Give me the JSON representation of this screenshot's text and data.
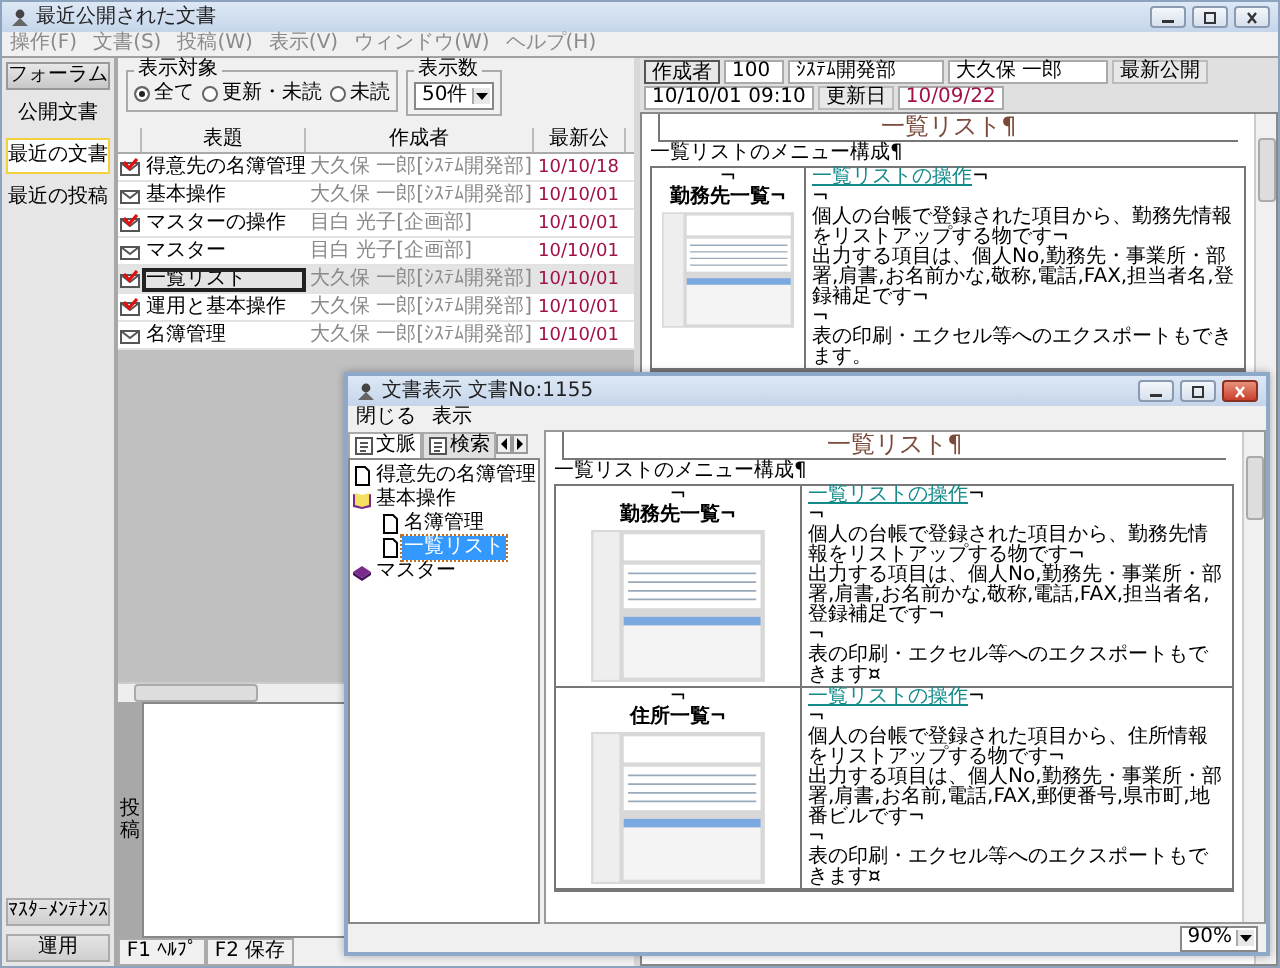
{
  "main_window": {
    "title": "最近公開された文書",
    "menu": [
      "操作(F)",
      "文書(S)",
      "投稿(W)",
      "表示(V)",
      "ウィンドウ(W)",
      "ヘルプ(H)"
    ]
  },
  "nav": {
    "header": "フォーラム",
    "items": [
      {
        "label": "公開文書",
        "selected": false
      },
      {
        "label": "最近の文書",
        "selected": true
      },
      {
        "label": "最近の投稿",
        "selected": false
      }
    ],
    "footer": [
      "ﾏｽﾀｰﾒﾝﾃﾅﾝｽ",
      "運用"
    ]
  },
  "filter": {
    "target_label": "表示対象",
    "options": [
      {
        "label": "全て",
        "selected": true
      },
      {
        "label": "更新・未読",
        "selected": false
      },
      {
        "label": "未読",
        "selected": false
      }
    ],
    "count_label": "表示数",
    "count_value": "50件"
  },
  "doc_list": {
    "columns": [
      "表題",
      "作成者",
      "最新公"
    ],
    "rows": [
      {
        "title": "得意先の名簿管理",
        "author": "大久保 一郎[ｼｽﾃﾑ開発部]",
        "date": "10/10/18",
        "kind": "updated",
        "selected": false
      },
      {
        "title": "基本操作",
        "author": "大久保 一郎[ｼｽﾃﾑ開発部]",
        "date": "10/10/01",
        "kind": "read",
        "selected": false
      },
      {
        "title": "マスターの操作",
        "author": "目白 光子[企画部]",
        "date": "10/10/01",
        "kind": "updated",
        "selected": false
      },
      {
        "title": "マスター",
        "author": "目白 光子[企画部]",
        "date": "10/10/01",
        "kind": "read",
        "selected": false
      },
      {
        "title": "一覧リスト",
        "author": "大久保 一郎[ｼｽﾃﾑ開発部]",
        "date": "10/10/01",
        "kind": "updated",
        "selected": true
      },
      {
        "title": "運用と基本操作",
        "author": "大久保 一郎[ｼｽﾃﾑ開発部]",
        "date": "10/10/01",
        "kind": "updated",
        "selected": false
      },
      {
        "title": "名簿管理",
        "author": "大久保 一郎[ｼｽﾃﾑ開発部]",
        "date": "10/10/01",
        "kind": "read",
        "selected": false
      }
    ]
  },
  "post_panel": {
    "label": "投稿"
  },
  "function_keys": [
    "F1 ﾍﾙﾌﾟ",
    "F2 保存"
  ],
  "doc_header": {
    "author_button": "作成者",
    "number": "100",
    "department": "ｼｽﾃﾑ開発部",
    "name": "大久保 一郎",
    "published_label": "最新公開",
    "published": "10/10/01 09:10",
    "updated_label": "更新日",
    "updated": "10/09/22"
  },
  "main_doc": {
    "title": "一覧リスト¶",
    "heading": "一覧リストのメニュー構成¶",
    "rows": [
      {
        "mark": "¬",
        "caption": "勤務先一覧¬",
        "link": "一覧リストの操作",
        "link_mark": "¬",
        "paragraphs": [
          "¬",
          "個人の台帳で登録された項目から、勤務先情報をリストアップする物です¬",
          "出力する項目は、個人No,勤務先・事業所・部署,肩書,お名前かな,敬称,電話,FAX,担当者名,登録補足です¬",
          "¬",
          "表の印刷・エクセル等へのエクスポートもできます。"
        ]
      }
    ]
  },
  "doc_window": {
    "title": "文書表示 文書No:1155",
    "menu": [
      "閉じる",
      "表示"
    ],
    "tabs": [
      {
        "label": "文脈",
        "selected": true
      },
      {
        "label": "検索",
        "selected": false
      }
    ],
    "tree": [
      {
        "label": "得意先の名簿管理",
        "kind": "page",
        "selected": false
      },
      {
        "label": "基本操作",
        "kind": "open_book",
        "selected": false,
        "children": [
          {
            "label": "名簿管理",
            "kind": "page",
            "selected": false
          },
          {
            "label": "一覧リスト",
            "kind": "page",
            "selected": true
          }
        ]
      },
      {
        "label": "マスター",
        "kind": "closed_book",
        "selected": false
      }
    ],
    "doc": {
      "title": "一覧リスト¶",
      "heading": "一覧リストのメニュー構成¶",
      "rows": [
        {
          "mark": "¬",
          "caption": "勤務先一覧¬",
          "link": "一覧リストの操作",
          "link_mark": "¬",
          "paragraphs": [
            "¬",
            "個人の台帳で登録された項目から、勤務先情報をリストアップする物です¬",
            "出力する項目は、個人No,勤務先・事業所・部署,肩書,お名前かな,敬称,電話,FAX,担当者名,登録補足です¬",
            "¬",
            "表の印刷・エクセル等へのエクスポートもできます¤"
          ]
        },
        {
          "mark": "¬",
          "caption": "住所一覧¬",
          "link": "一覧リストの操作",
          "link_mark": "¬",
          "paragraphs": [
            "¬",
            "個人の台帳で登録された項目から、住所情報をリストアップする物です¬",
            "出力する項目は、個人No,勤務先・事業所・部署,肩書,お名前,電話,FAX,郵便番号,県市町,地番ビルです¬",
            "¬",
            "表の印刷・エクセル等へのエクスポートもできます¤"
          ]
        }
      ]
    },
    "zoom": "90%"
  }
}
